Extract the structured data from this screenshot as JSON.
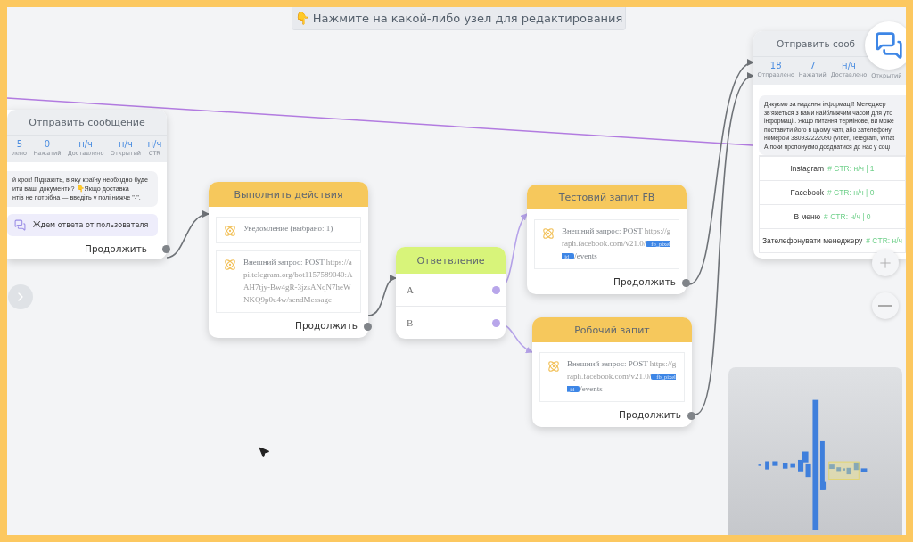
{
  "hint": "👇 Нажмите на какой-либо узел для редактирования",
  "nodes": [
    {
      "kind": "message",
      "title": "Отправить сообщение",
      "stats": [
        {
          "value": "5",
          "label": "лено"
        },
        {
          "value": "0",
          "label": "Нажатий"
        },
        {
          "value": "н/ч",
          "label": "Доставлено"
        },
        {
          "value": "н/ч",
          "label": "Открытий"
        },
        {
          "value": "н/ч",
          "label": "CTR"
        }
      ],
      "message": [
        "й крок! Підкажіть, в яку країну необхідно буде",
        "ити ваші документи? 👇Якщо доставка",
        "нтів не потрібна — введіть у полі нижче \"-\"."
      ],
      "waiting": "Ждем ответа от пользователя",
      "continue": "Продолжить"
    },
    {
      "kind": "action",
      "title": "Выполнить действия",
      "items": [
        {
          "text": "Уведомление (выбрано: 1)"
        },
        {
          "text": "Внешний запрос: POST",
          "url": "https://api.telegram.org/bot1157589040:AAH7tjy-Bw4gR-3jzsANqN7heWNKQ9p0u4w/sendMessage"
        }
      ],
      "continue": "Продолжить"
    },
    {
      "kind": "branch",
      "title": "Ответвление",
      "branches": [
        "A",
        "B"
      ]
    },
    {
      "kind": "action",
      "title": "Тестовий запит FB",
      "items": [
        {
          "text": "Внешний запрос: POST",
          "url": "https://graph.facebook.com/v21.0/",
          "tag": "fb_pixel_id",
          "url_after": "/events"
        }
      ],
      "continue": "Продолжить"
    },
    {
      "kind": "action",
      "title": "Робочий запит",
      "items": [
        {
          "text": "Внешний запрос: POST",
          "url": "https://graph.facebook.com/v21.0/",
          "tag": "fb_pixel_id",
          "url_after": "/events"
        }
      ],
      "continue": "Продолжить"
    },
    {
      "kind": "message",
      "title": "Отправить сооб",
      "stats": [
        {
          "value": "18",
          "label": "Отправлено"
        },
        {
          "value": "7",
          "label": "Нажатий"
        },
        {
          "value": "н/ч",
          "label": "Доставлено"
        },
        {
          "label": "Открытий"
        }
      ],
      "message": [
        "Дякуємо за надання інформації! Менеджер",
        "зв'яжеться з вами найближчим часом для уто",
        "інформації. Якщо питання термінове, ви може",
        "поставити його в цьому чаті, або зателефону",
        "номером 380932222090 (Viber, Telegram, What",
        "А поки пропонуємо доєднатися до нас у соці"
      ],
      "buttons": [
        {
          "label": "Instagram",
          "stat": "# CTR: н/ч | 1"
        },
        {
          "label": "Facebook",
          "stat": "# CTR: н/ч | 0"
        },
        {
          "label": "В меню",
          "stat": "# CTR: н/ч | 0"
        },
        {
          "label": "Зателефонувати менеджеру",
          "stat": "# CTR: н/ч"
        }
      ]
    }
  ]
}
